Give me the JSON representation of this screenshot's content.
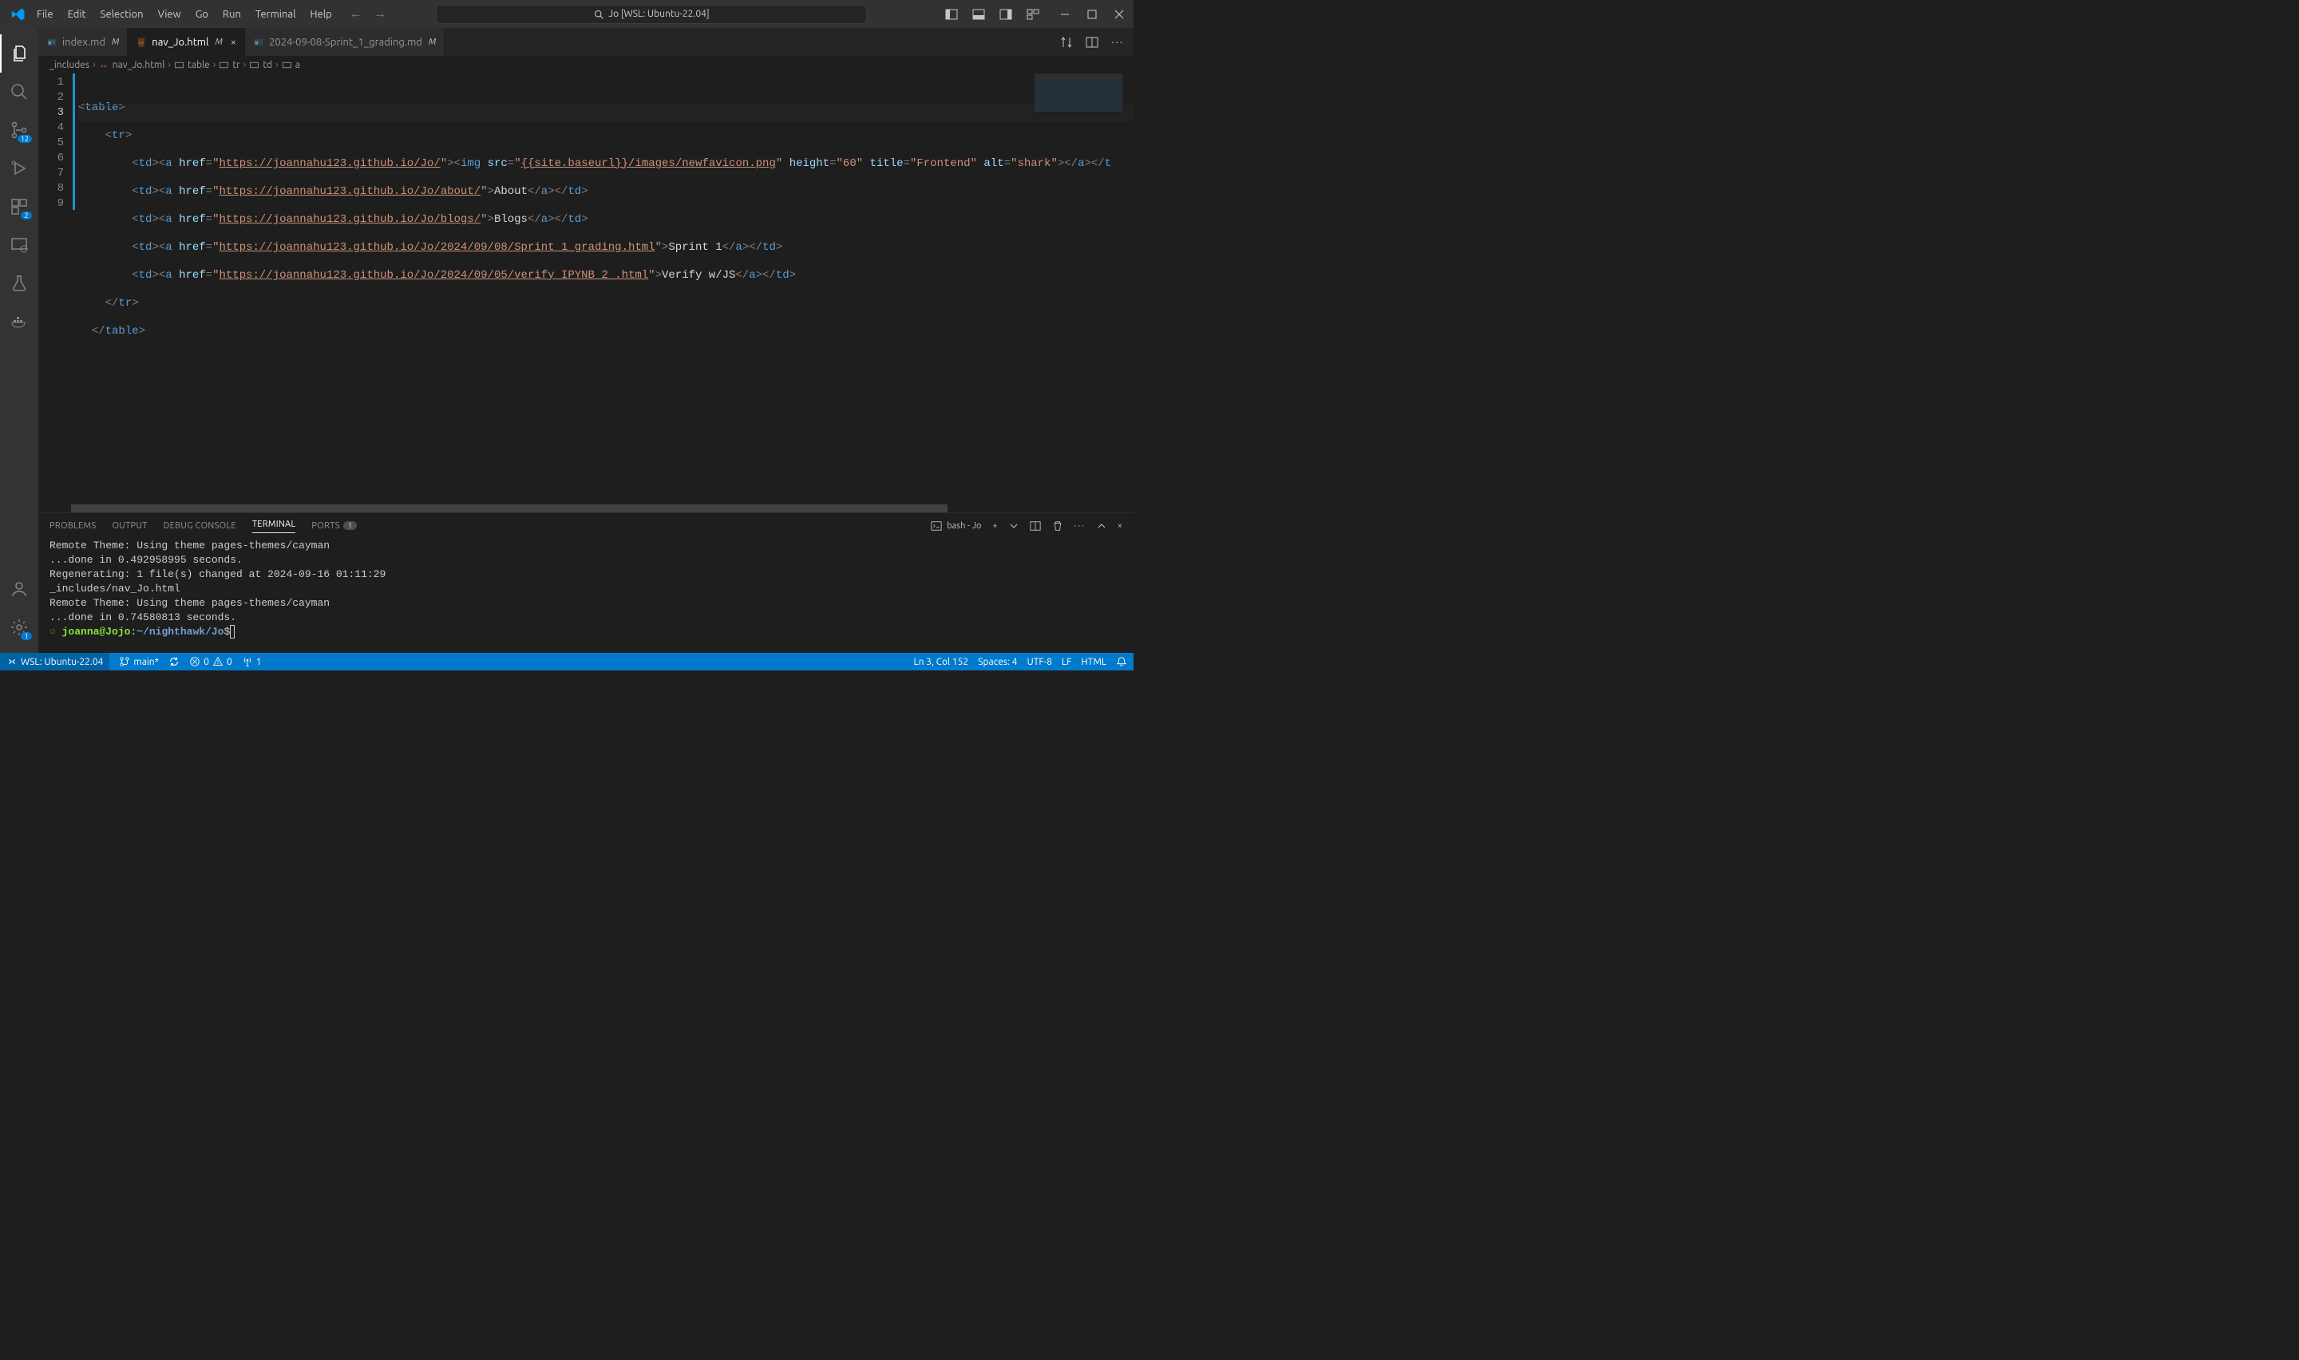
{
  "menu": {
    "file": "File",
    "edit": "Edit",
    "selection": "Selection",
    "view": "View",
    "go": "Go",
    "run": "Run",
    "terminal": "Terminal",
    "help": "Help"
  },
  "search": {
    "text": "Jo [WSL: Ubuntu-22.04]"
  },
  "activity": {
    "scm_badge": "12",
    "ext_badge": "2",
    "settings_badge": "1"
  },
  "tabs": {
    "items": [
      {
        "name": "index.md",
        "mod": "M"
      },
      {
        "name": "nav_Jo.html",
        "mod": "M"
      },
      {
        "name": "2024-09-08-Sprint_1_grading.md",
        "mod": "M"
      }
    ]
  },
  "breadcrumbs": {
    "folder": "_includes",
    "file": "nav_Jo.html",
    "b1": "table",
    "b2": "tr",
    "b3": "td",
    "b4": "a"
  },
  "code": {
    "lines": [
      "1",
      "2",
      "3",
      "4",
      "5",
      "6",
      "7",
      "8",
      "9"
    ],
    "url1": "https://joannahu123.github.io/Jo/",
    "img_src": "{{site.baseurl}}/images/newfavicon.png",
    "height": "60",
    "title_attr": "Frontend",
    "alt": "shark",
    "url2": "https://joannahu123.github.io/Jo/about/",
    "txt2": "About",
    "url3": "https://joannahu123.github.io/Jo/blogs/",
    "txt3": "Blogs",
    "url4": "https://joannahu123.github.io/Jo/2024/09/08/Sprint_1_grading.html",
    "txt4": "Sprint 1",
    "url5": "https://joannahu123.github.io/Jo/2024/09/05/verify_IPYNB_2_.html",
    "txt5": "Verify w/JS"
  },
  "panel": {
    "problems": "PROBLEMS",
    "output": "OUTPUT",
    "debug": "DEBUG CONSOLE",
    "terminal": "TERMINAL",
    "ports": "PORTS",
    "ports_count": "1",
    "shell": "bash - Jo"
  },
  "terminal": {
    "l1": "Remote Theme: Using theme pages-themes/cayman",
    "l2": "       ...done in 0.492958995 seconds.",
    "l3": "Regenerating: 1 file(s) changed at 2024-09-16 01:11:29",
    "l4": "              _includes/nav_Jo.html",
    "l5": "Remote Theme: Using theme pages-themes/cayman",
    "l6": "       ...done in 0.74580813 seconds.",
    "prompt_user": "joanna@Jojo",
    "prompt_colon": ":",
    "prompt_path": "~/nighthawk/Jo",
    "prompt_dollar": "$ "
  },
  "status": {
    "remote": "WSL: Ubuntu-22.04",
    "branch": "main*",
    "errors": "0",
    "warnings": "0",
    "ports_icon": "1",
    "ln": "Ln 3, Col 152",
    "spaces": "Spaces: 4",
    "encoding": "UTF-8",
    "eol": "LF",
    "lang": "HTML"
  }
}
